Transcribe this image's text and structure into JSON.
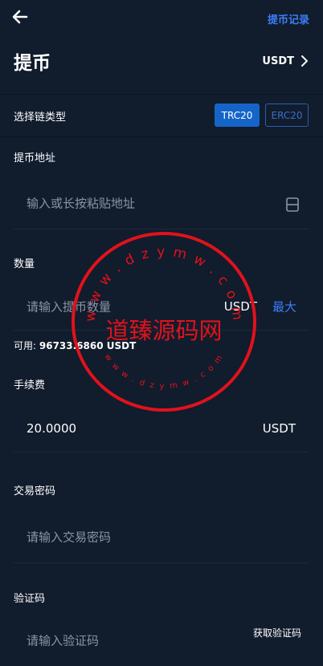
{
  "header": {
    "back_icon": "arrow-left-icon",
    "history_label": "提币记录"
  },
  "page": {
    "title": "提币",
    "coin_label": "USDT"
  },
  "chain": {
    "label": "选择链类型",
    "options": [
      "TRC20",
      "ERC20"
    ],
    "selected": "TRC20"
  },
  "address": {
    "label": "提币地址",
    "placeholder": "输入或长按粘贴地址"
  },
  "amount": {
    "label": "数量",
    "placeholder": "请输入提币数量",
    "unit": "USDT",
    "max_label": "最大",
    "available_prefix": "可用:",
    "available_value": "96733.6860 USDT"
  },
  "fee": {
    "label": "手续费",
    "value": "20.0000",
    "unit": "USDT"
  },
  "trade_password": {
    "label": "交易密码",
    "placeholder": "请输入交易密码"
  },
  "verify_code": {
    "label": "验证码",
    "placeholder": "请输入验证码",
    "get_code_label": "获取验证码"
  },
  "watermark": {
    "text": "道臻源码网",
    "ring_text": "w w w . d z y m w . c o m"
  },
  "colors": {
    "background": "#111c2d",
    "accent": "#3d7ef7",
    "button_active": "#1565c9",
    "watermark": "#e0121b"
  }
}
